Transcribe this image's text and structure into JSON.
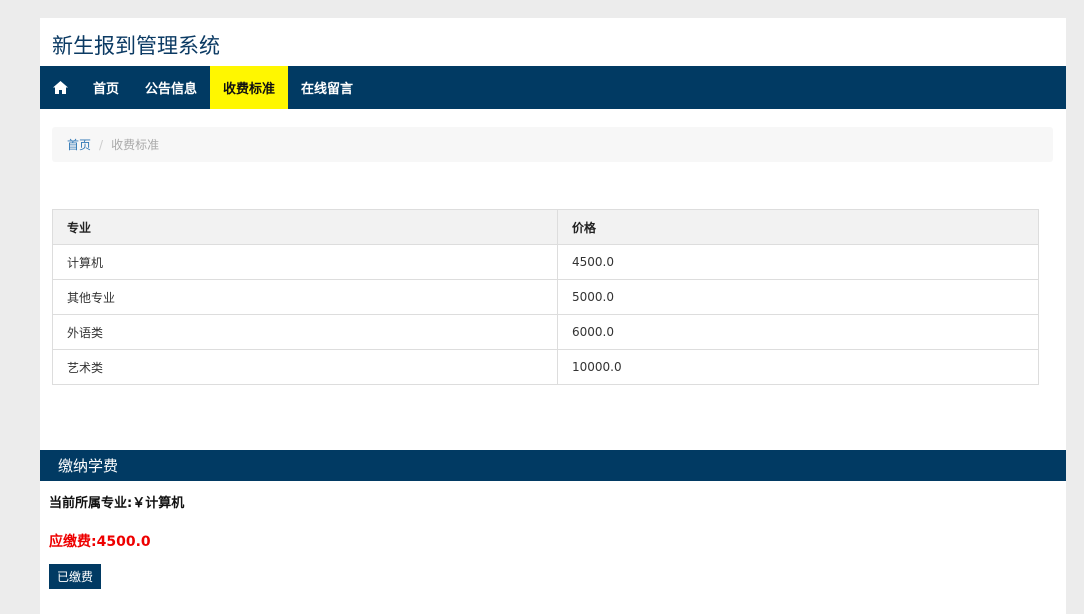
{
  "site": {
    "title": "新生报到管理系统"
  },
  "nav": {
    "home_icon": "home-icon",
    "items": [
      {
        "label": "首页",
        "active": false
      },
      {
        "label": "公告信息",
        "active": false
      },
      {
        "label": "收费标准",
        "active": true
      },
      {
        "label": "在线留言",
        "active": false
      }
    ]
  },
  "breadcrumb": {
    "home": "首页",
    "separator": "/",
    "current": "收费标准"
  },
  "fee_table": {
    "headers": [
      "专业",
      "价格"
    ],
    "rows": [
      [
        "计算机",
        "4500.0"
      ],
      [
        "其他专业",
        "5000.0"
      ],
      [
        "外语类",
        "6000.0"
      ],
      [
        "艺术类",
        "10000.0"
      ]
    ]
  },
  "payment": {
    "header": "缴纳学费",
    "current_major": "当前所属专业:￥计算机",
    "due_fee": "应缴费:4500.0",
    "paid_button": "已缴费"
  },
  "colors": {
    "brand": "#013a63",
    "active_nav": "#fff700",
    "due_fee": "#ee0000"
  }
}
